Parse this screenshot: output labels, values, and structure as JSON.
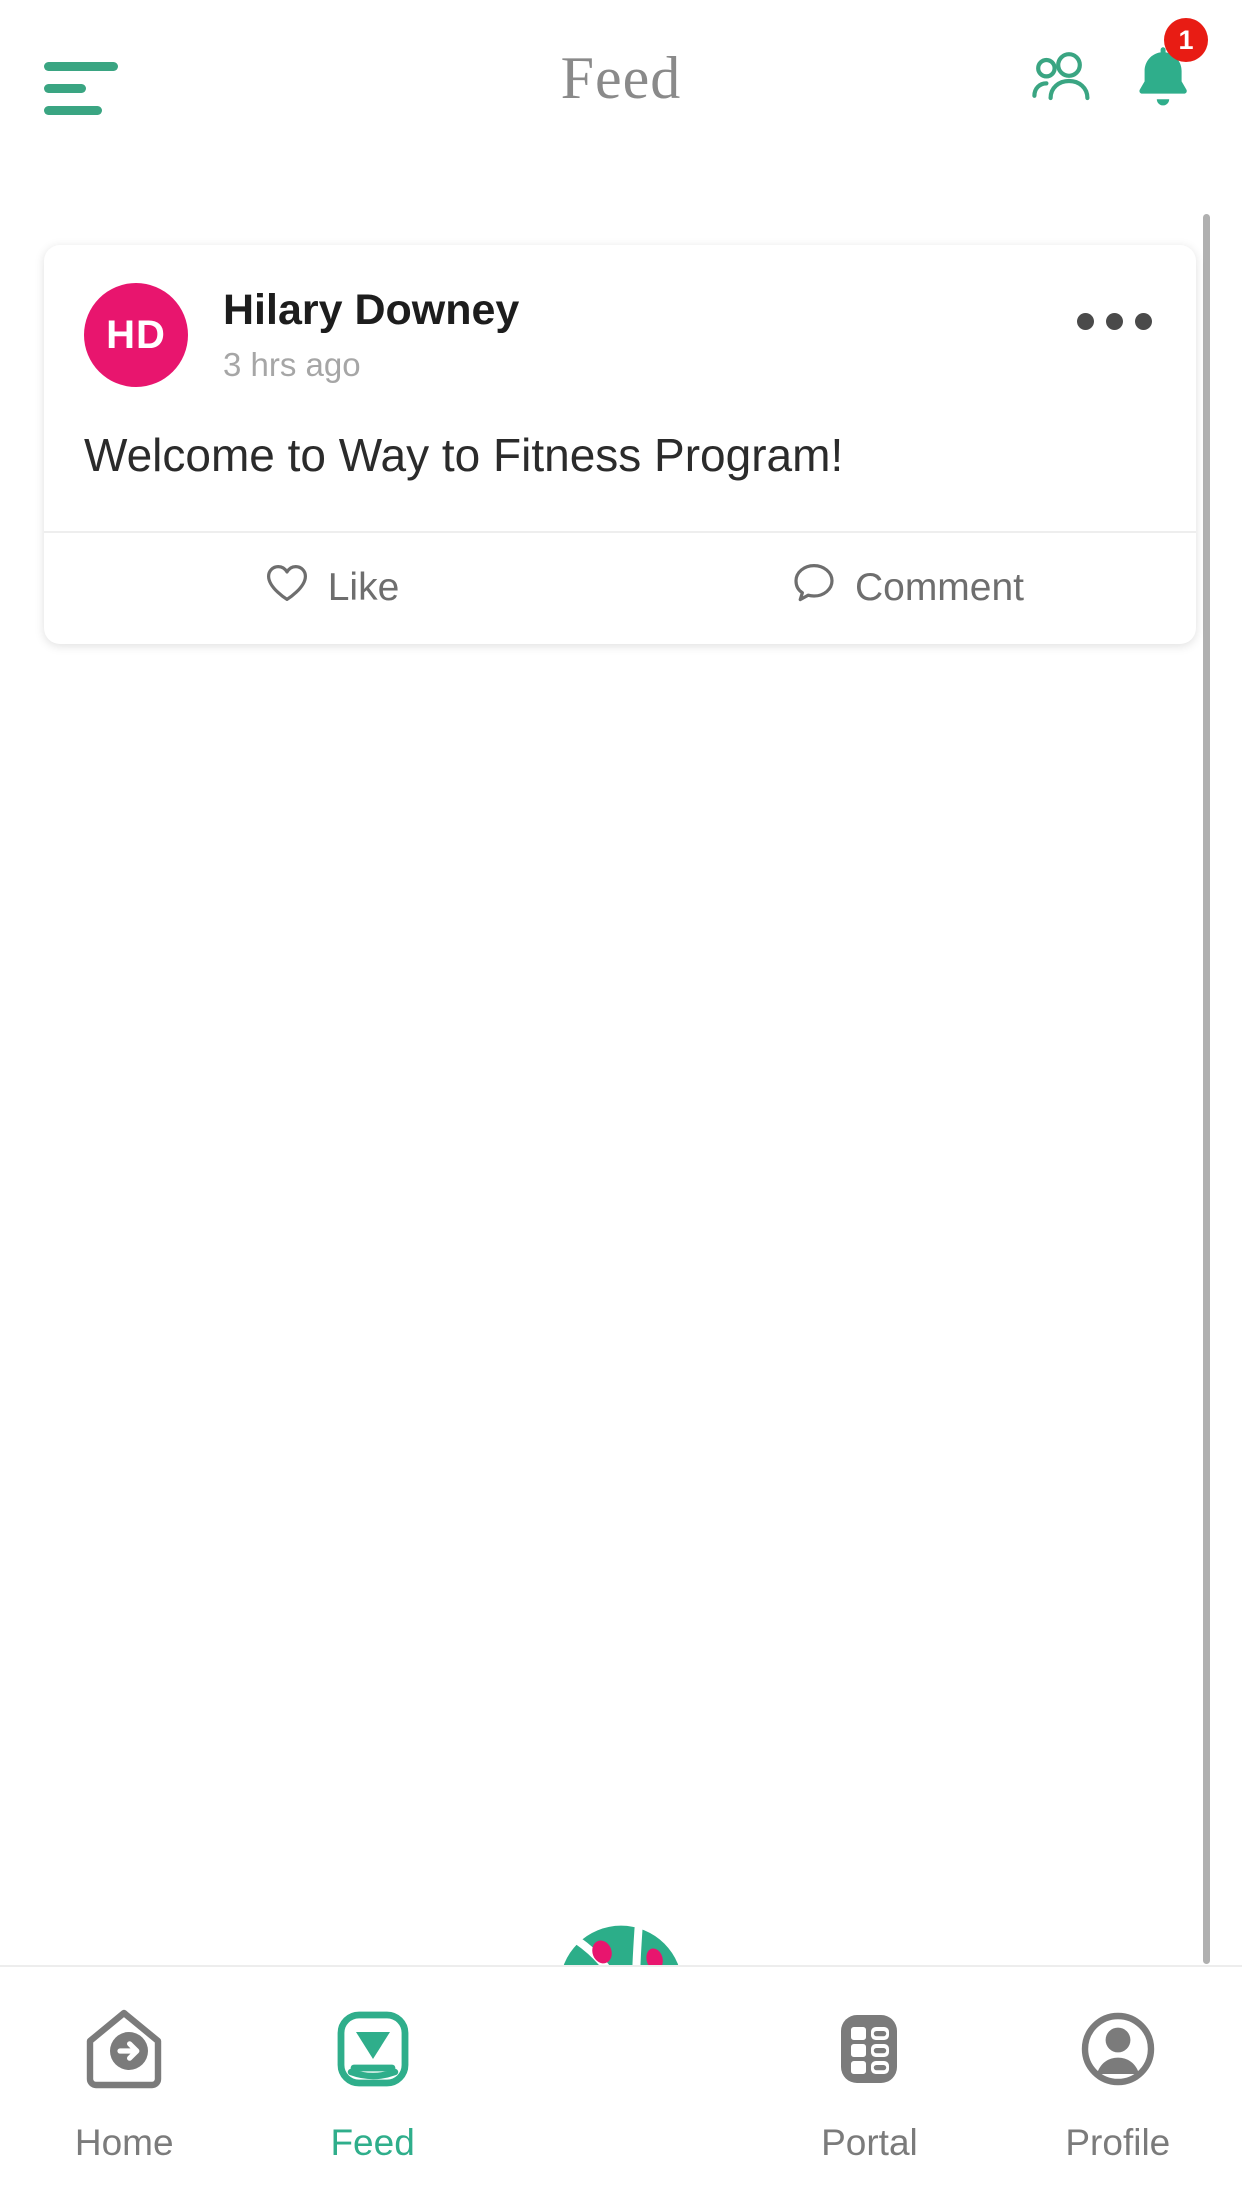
{
  "header": {
    "title": "Feed",
    "menu_icon": "hamburger-menu-icon",
    "people_icon": "people-icon",
    "bell_icon": "bell-icon",
    "notification_count": "1",
    "accent_color": "#3aa582",
    "badge_color": "#e81c14",
    "title_color": "#8a8a8a"
  },
  "feed": {
    "posts": [
      {
        "avatar_initials": "HD",
        "avatar_color": "#e8156e",
        "author": "Hilary Downey",
        "timestamp": "3 hrs ago",
        "body": "Welcome to Way to Fitness Program!",
        "more_icon": "more-options-icon",
        "actions": [
          {
            "label": "Like",
            "icon": "heart-outline-icon"
          },
          {
            "label": "Comment",
            "icon": "comment-bubble-icon"
          }
        ]
      }
    ]
  },
  "center_action": {
    "icon": "basketball-logo-icon",
    "ball_color": "#2cae89",
    "dot_color": "#e8156e"
  },
  "bottom_nav": {
    "active_index": 1,
    "active_color": "#2fae8b",
    "inactive_color": "#7b7b7b",
    "items": [
      {
        "label": "Home",
        "icon": "home-arrow-icon"
      },
      {
        "label": "Feed",
        "icon": "feed-inbox-icon"
      },
      {
        "label": "Portal",
        "icon": "portal-list-icon"
      },
      {
        "label": "Profile",
        "icon": "profile-person-icon"
      }
    ]
  }
}
